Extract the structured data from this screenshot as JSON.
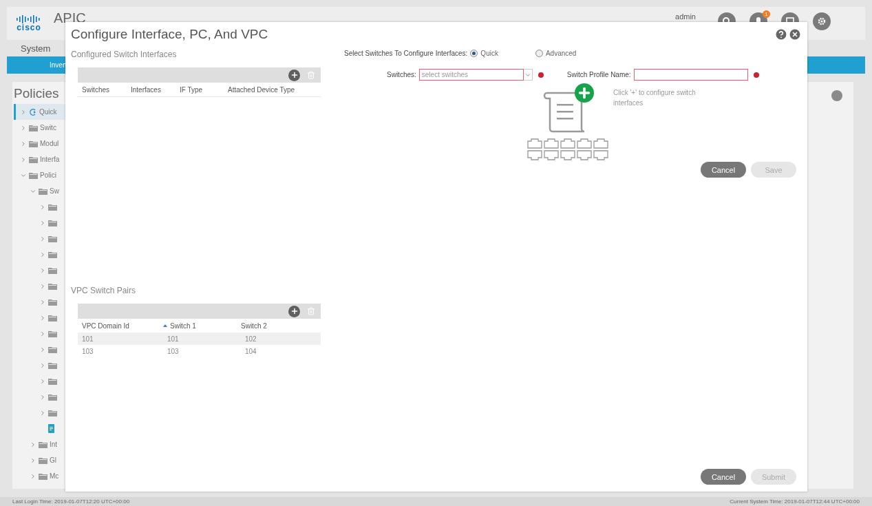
{
  "header": {
    "logo": "cisco",
    "app_name": "APIC",
    "user": "admin",
    "notification_count": "1"
  },
  "nav": {
    "tab": "System",
    "subtab": "Inven"
  },
  "sidebar": {
    "title": "Policies",
    "tree": [
      {
        "label": "Quick",
        "kind": "quickstart",
        "expanded": false,
        "selected": true
      },
      {
        "label": "Switc",
        "kind": "folder",
        "expanded": false,
        "selected": false
      },
      {
        "label": "Modul",
        "kind": "folder",
        "expanded": false,
        "selected": false
      },
      {
        "label": "Interfa",
        "kind": "folder",
        "expanded": false,
        "selected": false
      },
      {
        "label": "Polici",
        "kind": "folder",
        "expanded": true,
        "selected": false,
        "children": [
          {
            "label": "Sw",
            "kind": "folder",
            "expanded": true,
            "selected": false,
            "children": [
              {
                "kind": "folder",
                "expanded": false,
                "selected": false
              },
              {
                "kind": "folder",
                "expanded": false,
                "selected": false
              },
              {
                "kind": "folder",
                "expanded": false,
                "selected": false
              },
              {
                "kind": "folder",
                "expanded": false,
                "selected": false
              },
              {
                "kind": "folder",
                "expanded": false,
                "selected": false
              },
              {
                "kind": "folder",
                "expanded": false,
                "selected": false
              },
              {
                "kind": "folder",
                "expanded": false,
                "selected": false
              },
              {
                "kind": "folder",
                "expanded": false,
                "selected": false
              },
              {
                "kind": "folder",
                "expanded": false,
                "selected": false
              },
              {
                "kind": "folder",
                "expanded": false,
                "selected": false
              },
              {
                "kind": "folder",
                "expanded": false,
                "selected": false
              },
              {
                "kind": "folder",
                "expanded": false,
                "selected": false
              },
              {
                "kind": "folder",
                "expanded": false,
                "selected": false
              },
              {
                "kind": "folder",
                "expanded": false,
                "selected": false
              },
              {
                "kind": "document",
                "selected": false
              }
            ]
          },
          {
            "label": "Int",
            "kind": "folder",
            "expanded": false,
            "selected": false
          },
          {
            "label": "Gl",
            "kind": "folder",
            "expanded": false,
            "selected": false
          },
          {
            "label": "Mc",
            "kind": "folder",
            "expanded": false,
            "selected": false
          }
        ]
      }
    ]
  },
  "dialog": {
    "title": "Configure Interface, PC, And VPC",
    "interfaces_table": {
      "title": "Configured Switch Interfaces",
      "columns": [
        "Switches",
        "Interfaces",
        "IF Type",
        "Attached Device Type"
      ]
    },
    "vpc_table": {
      "title": "VPC Switch Pairs",
      "columns": [
        {
          "label": "VPC Domain Id",
          "sorted": false
        },
        {
          "label": "Switch 1",
          "sorted": true
        },
        {
          "label": "Switch 2",
          "sorted": false
        }
      ],
      "rows": [
        {
          "cells": [
            "101",
            "101",
            "102"
          ],
          "selected": true
        },
        {
          "cells": [
            "103",
            "103",
            "104"
          ],
          "selected": false
        }
      ]
    },
    "mode": {
      "label": "Select Switches To Configure Interfaces:",
      "options": [
        {
          "label": "Quick",
          "selected": true
        },
        {
          "label": "Advanced",
          "selected": false
        }
      ]
    },
    "switches_field": {
      "label": "Switches:",
      "placeholder": "select switches"
    },
    "profile_field": {
      "label": "Switch Profile Name:"
    },
    "hint": "Click '+' to configure switch interfaces",
    "form_buttons": [
      {
        "label": "Cancel",
        "disabled": false
      },
      {
        "label": "Save",
        "disabled": true
      }
    ],
    "footer_buttons": [
      {
        "label": "Cancel",
        "disabled": false
      },
      {
        "label": "Submit",
        "disabled": true
      }
    ]
  },
  "status_bar": {
    "left": "Last Login Time: 2019-01-07T12:20 UTC+00:00",
    "right": "Current System Time: 2019-01-07T12:44 UTC+00:00"
  }
}
